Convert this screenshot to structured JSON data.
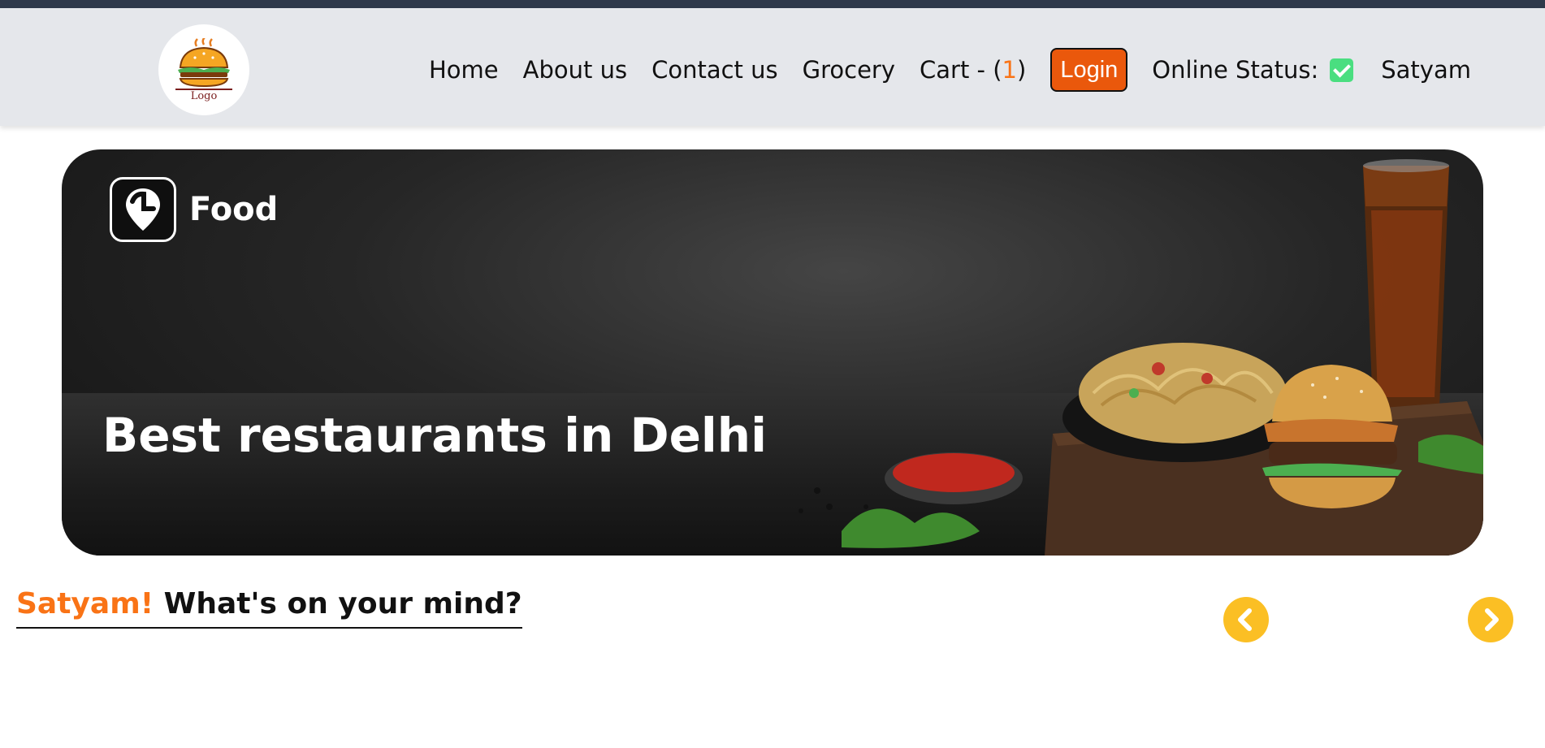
{
  "header": {
    "logo_caption": "Logo",
    "nav": [
      {
        "label": "Home"
      },
      {
        "label": "About us"
      },
      {
        "label": "Contact us"
      },
      {
        "label": "Grocery"
      }
    ],
    "cart": {
      "prefix": "Cart - (",
      "count": "1",
      "suffix": ")"
    },
    "login_label": "Login",
    "status_label": "Online Status:",
    "status_icon": "checkbox-checked-icon",
    "user_name": "Satyam"
  },
  "banner": {
    "brand_label": "Food",
    "brand_icon": "location-pin-icon",
    "title": "Best restaurants in Delhi"
  },
  "section": {
    "greeting_name": "Satyam!",
    "greeting_text": " What's on your mind?",
    "prev_icon": "chevron-left-icon",
    "next_icon": "chevron-right-icon"
  },
  "colors": {
    "accent": "#f97316",
    "login_bg": "#ea580c",
    "arrow_bg": "#fbbf24",
    "navbar_bg": "#e5e7eb",
    "status_check": "#4ade80"
  }
}
